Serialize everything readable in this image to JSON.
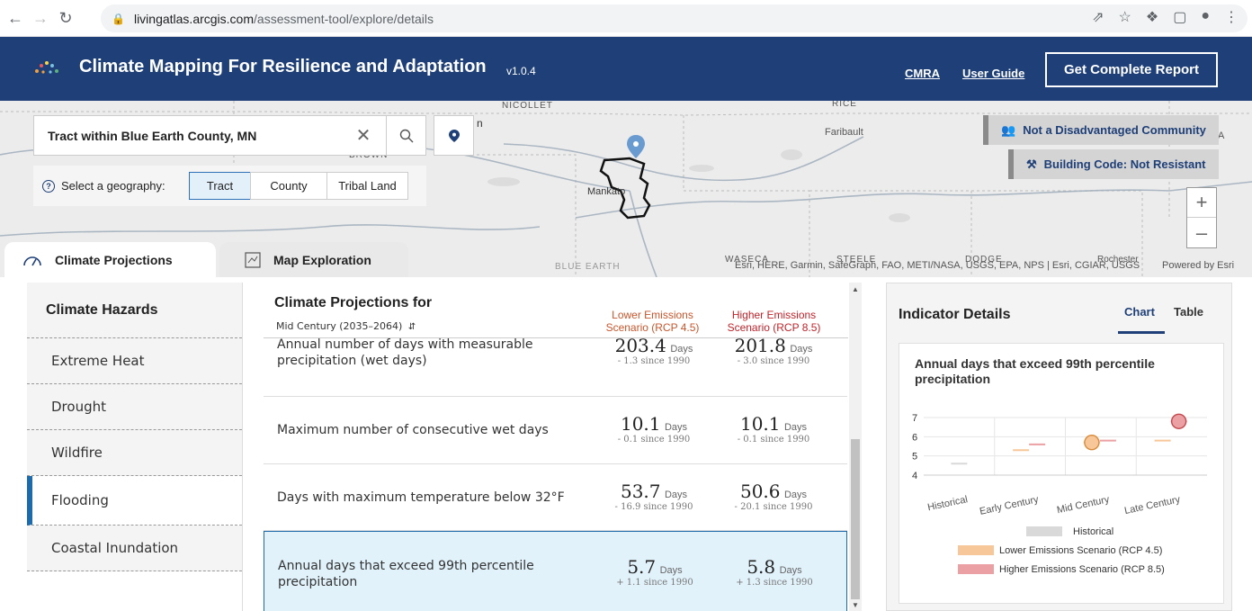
{
  "browser": {
    "url_host": "livingatlas.arcgis.com",
    "url_path": "/assessment-tool/explore/details"
  },
  "header": {
    "title": "Climate Mapping For Resilience and Adaptation",
    "version": "v1.0.4",
    "link_cmra": "CMRA",
    "link_guide": "User Guide",
    "report_button": "Get Complete Report",
    "color": "#1e3f77"
  },
  "map": {
    "search_value": "Tract within Blue Earth County, MN",
    "geo_label": "Select a geography:",
    "geo_options": [
      "Tract",
      "County",
      "Tribal Land"
    ],
    "geo_selected": "Tract",
    "badge_disadvantaged": "Not a Disadvantaged Community",
    "badge_building": "Building Code: Not Resistant",
    "labels": {
      "nicollet": "NICOLLET",
      "rice": "RICE",
      "brown": "BROWN",
      "faribault": "Faribault",
      "mankato": "Mankato",
      "waseca": "WASECA",
      "steele": "STEELE",
      "dodge": "DODGE",
      "rochester": "Rochester",
      "blue_earth": "BLUE EARTH",
      "n_fragment": "n",
      "a_fragment": "A"
    },
    "attribution": "Esri, HERE, Garmin, SafeGraph, FAO, METI/NASA, USGS, EPA, NPS | Esri, CGIAR, USGS",
    "powered_by": "Powered by Esri"
  },
  "tabs": {
    "projections": "Climate Projections",
    "exploration": "Map Exploration"
  },
  "sidebar": {
    "heading": "Climate Hazards",
    "items": [
      "Extreme Heat",
      "Drought",
      "Wildfire",
      "Flooding",
      "Coastal Inundation"
    ],
    "active": "Flooding"
  },
  "projections": {
    "title": "Climate Projections for",
    "period": "Mid Century (2035–2064)",
    "lower_scenario": [
      "Lower Emissions",
      "Scenario (RCP 4.5)"
    ],
    "higher_scenario": [
      "Higher Emissions",
      "Scenario (RCP 8.5)"
    ],
    "rows": [
      {
        "label": "Annual number of days with measurable precipitation (wet days)",
        "low": "203.4",
        "low_unit": "Days",
        "low_change": "- 1.3 since 1990",
        "high": "201.8",
        "high_unit": "Days",
        "high_change": "- 3.0 since 1990"
      },
      {
        "label": "Maximum number of consecutive wet days",
        "low": "10.1",
        "low_unit": "Days",
        "low_change": "- 0.1 since 1990",
        "high": "10.1",
        "high_unit": "Days",
        "high_change": "- 0.1 since 1990"
      },
      {
        "label": "Days with maximum temperature below 32°F",
        "low": "53.7",
        "low_unit": "Days",
        "low_change": "- 16.9 since 1990",
        "high": "50.6",
        "high_unit": "Days",
        "high_change": "- 20.1 since 1990"
      },
      {
        "label": "Annual days that exceed 99th percentile precipitation",
        "low": "5.7",
        "low_unit": "Days",
        "low_change": "+ 1.1 since 1990",
        "high": "5.8",
        "high_unit": "Days",
        "high_change": "+ 1.3 since 1990"
      }
    ]
  },
  "indicator": {
    "title": "Indicator Details",
    "tab_chart": "Chart",
    "tab_table": "Table",
    "chart_title": "Annual days that exceed 99th percentile precipitation"
  },
  "chart_data": {
    "type": "scatter",
    "categories": [
      "Historical",
      "Early Century",
      "Mid Century",
      "Late Century"
    ],
    "ylim": [
      4,
      7
    ],
    "yticks": [
      4,
      5,
      6,
      7
    ],
    "series": [
      {
        "name": "Historical",
        "color": "#d9d9d9",
        "values": [
          4.6,
          null,
          null,
          null
        ]
      },
      {
        "name": "Lower Emissions Scenario (RCP 4.5)",
        "color": "#f7c79a",
        "values": [
          null,
          5.3,
          5.7,
          5.8
        ]
      },
      {
        "name": "Higher Emissions Scenario (RCP 8.5)",
        "color": "#eba0a3",
        "values": [
          null,
          5.6,
          5.8,
          6.8
        ]
      }
    ],
    "highlight": {
      "category": "Mid Century",
      "series": "Lower Emissions Scenario (RCP 4.5)",
      "value": 5.7
    }
  }
}
